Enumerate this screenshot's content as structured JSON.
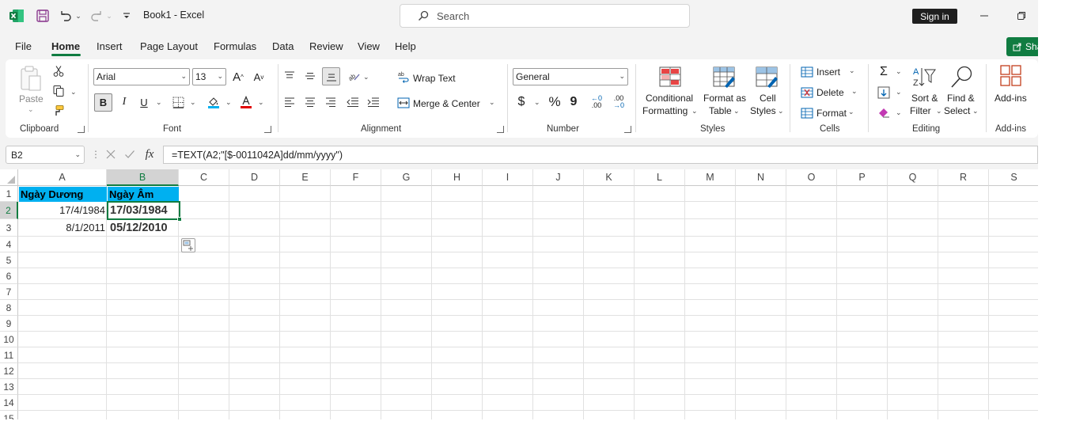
{
  "window": {
    "title": "Book1  -  Excel",
    "search_placeholder": "Search",
    "signin_label": "Sign in",
    "share_label": "Sha"
  },
  "tabs": [
    {
      "label": "File"
    },
    {
      "label": "Home"
    },
    {
      "label": "Insert"
    },
    {
      "label": "Page Layout"
    },
    {
      "label": "Formulas"
    },
    {
      "label": "Data"
    },
    {
      "label": "Review"
    },
    {
      "label": "View"
    },
    {
      "label": "Help"
    }
  ],
  "ribbon": {
    "clipboard": {
      "paste": "Paste",
      "group": "Clipboard"
    },
    "font": {
      "name": "Arial",
      "size": "13",
      "bold": "B",
      "italic": "I",
      "underline": "U",
      "grow": "A",
      "shrink": "A",
      "group": "Font"
    },
    "alignment": {
      "wrap": "Wrap Text",
      "merge": "Merge & Center",
      "group": "Alignment"
    },
    "number": {
      "format": "General",
      "currency": "$",
      "percent": "%",
      "comma": "9",
      "inc_decimal": ".00",
      "dec_decimal": ".00",
      "group": "Number"
    },
    "styles": {
      "conditional_1": "Conditional",
      "conditional_2": "Formatting",
      "table_1": "Format as",
      "table_2": "Table",
      "cell_1": "Cell",
      "cell_2": "Styles",
      "group": "Styles"
    },
    "cells": {
      "insert": "Insert",
      "delete": "Delete",
      "format": "Format",
      "group": "Cells"
    },
    "editing": {
      "sort_1": "Sort &",
      "sort_2": "Filter",
      "find_1": "Find &",
      "find_2": "Select",
      "group": "Editing"
    },
    "addins": {
      "label": "Add-ins",
      "group": "Add-ins"
    }
  },
  "formula_bar": {
    "name_box": "B2",
    "fx": "fx",
    "formula": "=TEXT(A2;\"[$-0011042A]dd/mm/yyyy\")"
  },
  "sheet": {
    "columns": [
      "A",
      "B",
      "C",
      "D",
      "E",
      "F",
      "G",
      "H",
      "I",
      "J",
      "K",
      "L",
      "M",
      "N",
      "O",
      "P",
      "Q",
      "R",
      "S"
    ],
    "rows": [
      "1",
      "2",
      "3",
      "4",
      "5",
      "6",
      "7",
      "8",
      "9",
      "10",
      "11",
      "12",
      "13",
      "14",
      "15"
    ],
    "header_fill_color": "#00b0f0",
    "selection_color": "#107c41",
    "cells": {
      "A1": "Ngày Dương",
      "B1": "Ngày Âm",
      "A2": "17/4/1984",
      "B2": "17/03/1984",
      "A3": "8/1/2011",
      "B3": "05/12/2010"
    }
  }
}
